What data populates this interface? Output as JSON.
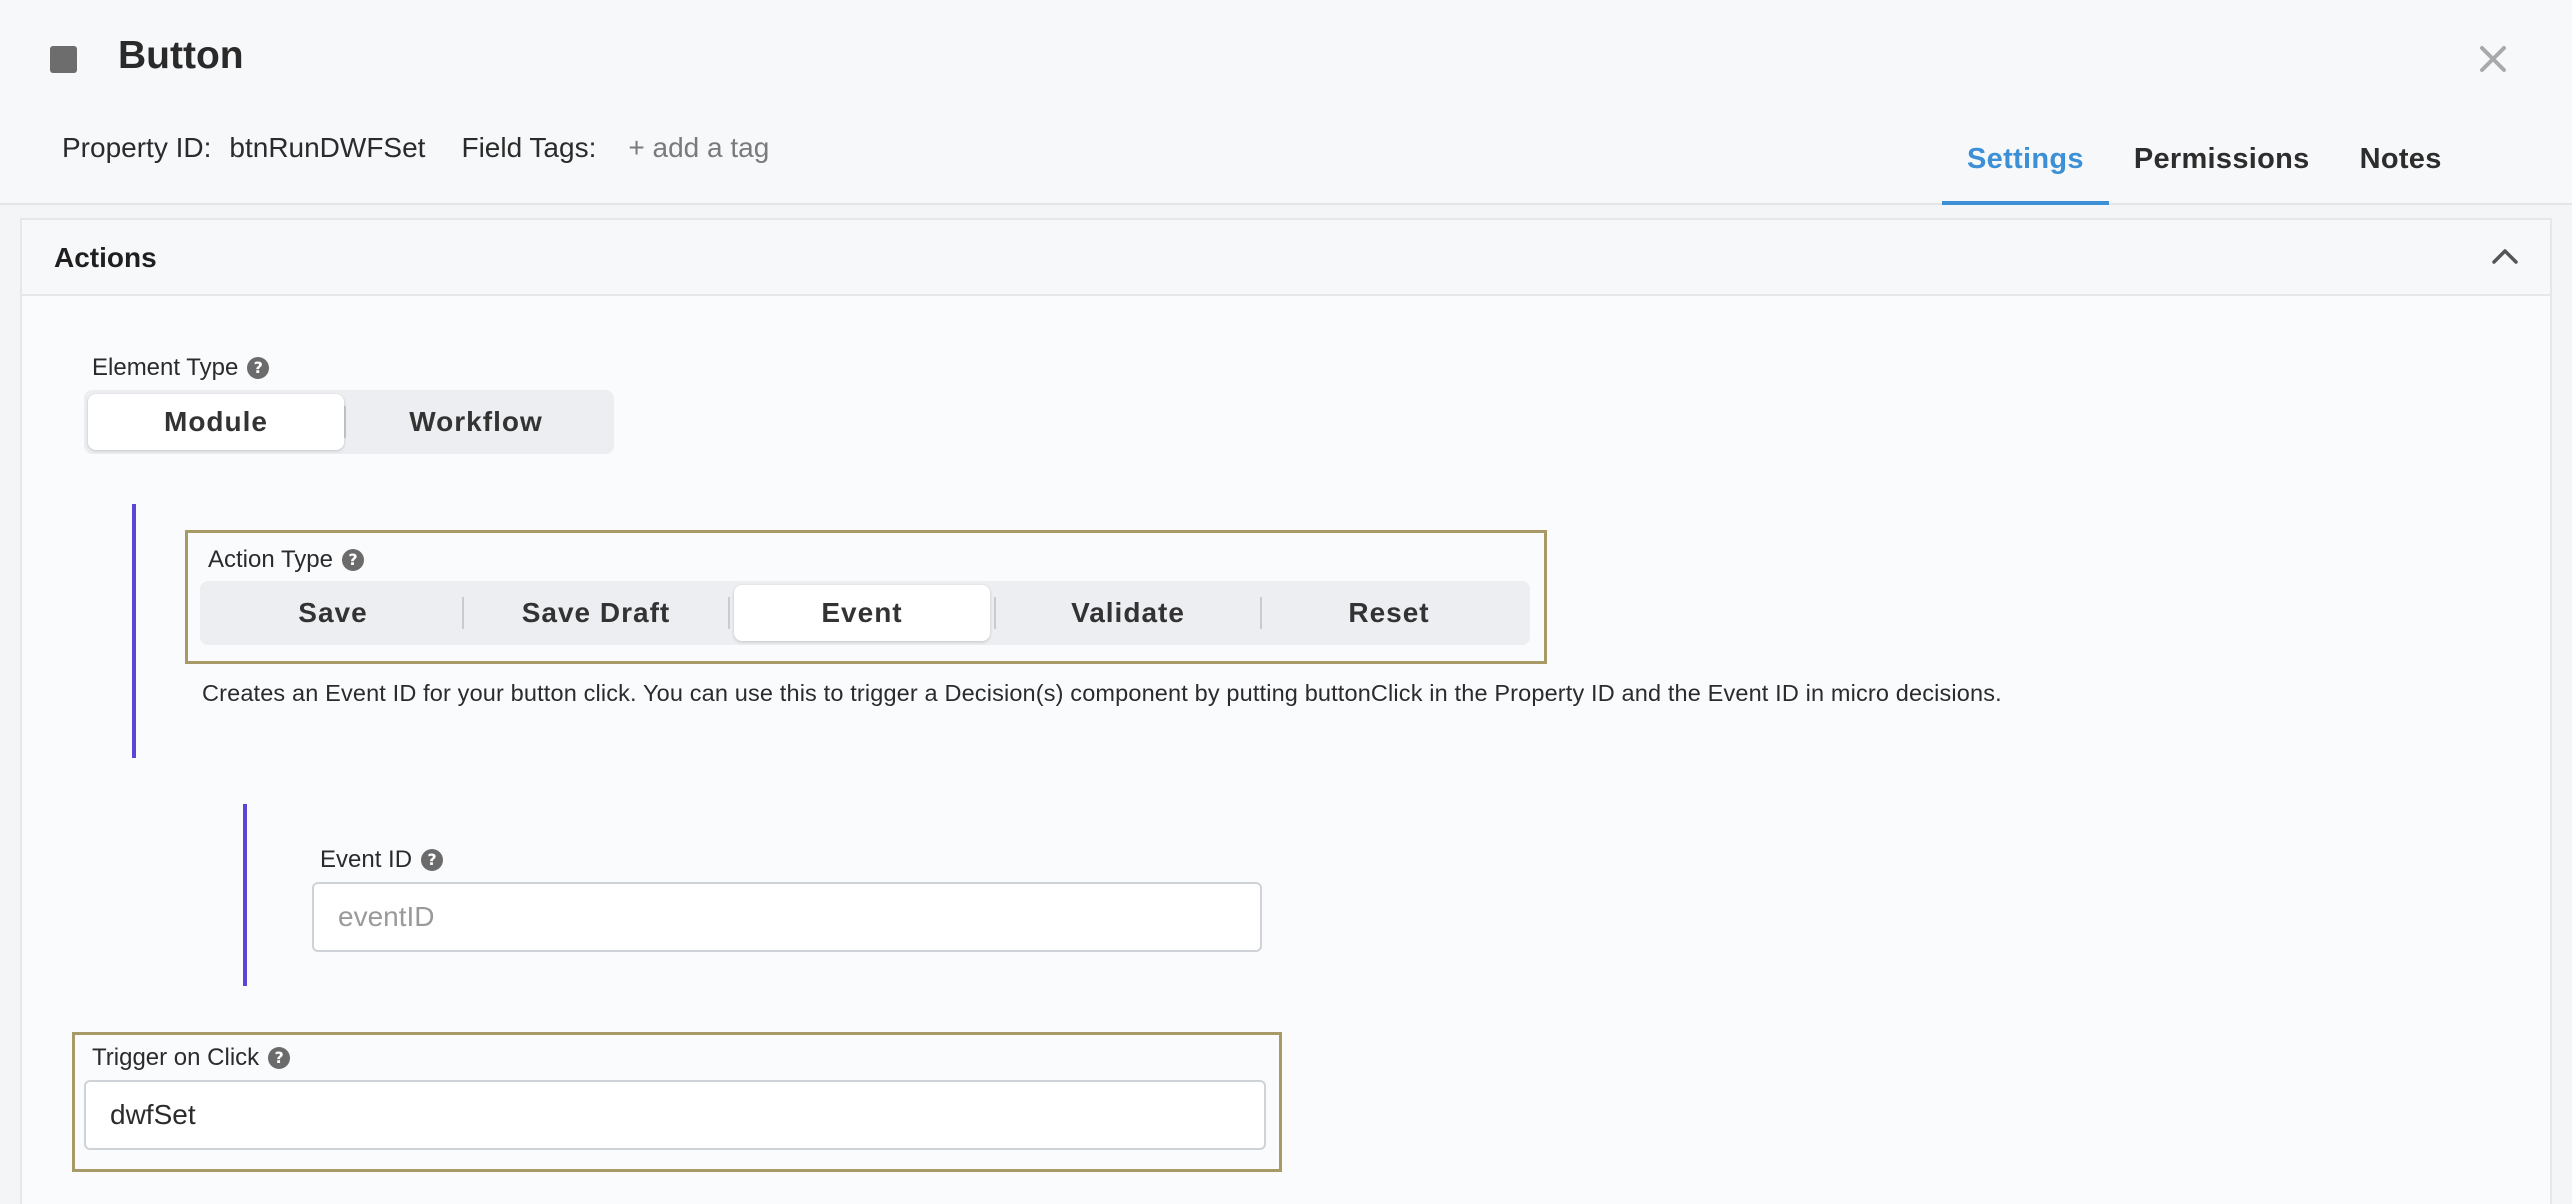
{
  "header": {
    "title": "Button",
    "property_id_label": "Property ID:",
    "property_id_value": "btnRunDWFSet",
    "field_tags_label": "Field Tags:",
    "add_tag_label": "+ add a tag"
  },
  "tabs": [
    {
      "label": "Settings",
      "active": true
    },
    {
      "label": "Permissions",
      "active": false
    },
    {
      "label": "Notes",
      "active": false
    }
  ],
  "panel": {
    "title": "Actions"
  },
  "element_type": {
    "label": "Element Type",
    "options": [
      "Module",
      "Workflow"
    ],
    "selected": "Module"
  },
  "action_type": {
    "label": "Action Type",
    "options": [
      "Save",
      "Save Draft",
      "Event",
      "Validate",
      "Reset"
    ],
    "selected": "Event",
    "description": "Creates an Event ID for your button click. You can use this to trigger a Decision(s) component by putting buttonClick in the Property ID and the Event ID in micro decisions."
  },
  "event_id": {
    "label": "Event ID",
    "placeholder": "eventID",
    "value": ""
  },
  "trigger_on_click": {
    "label": "Trigger on Click",
    "value": "dwfSet"
  },
  "colors": {
    "accent": "#3d8fd6",
    "highlight_border": "#a79a66",
    "nested_bar": "#5a47d6"
  }
}
